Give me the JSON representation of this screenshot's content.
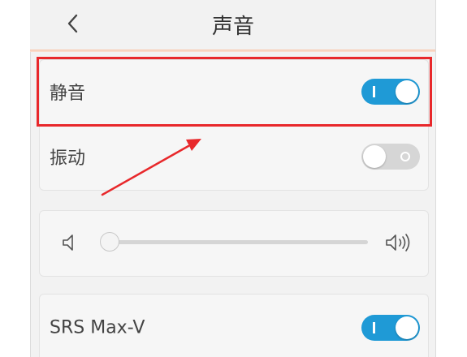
{
  "header": {
    "title": "声音",
    "back_icon": "chevron-left-icon"
  },
  "settings": {
    "mute": {
      "label": "静音",
      "on": true
    },
    "vibrate": {
      "label": "振动",
      "on": false
    },
    "volume": {
      "level": 0.0,
      "low_icon": "volume-low-icon",
      "high_icon": "volume-high-icon"
    },
    "srs": {
      "label": "SRS Max-V",
      "on": true
    }
  },
  "colors": {
    "accent": "#1f9ad6",
    "annotation": "#e8282b",
    "toggle_off": "#d6d6d6",
    "background": "#f2f2f2"
  }
}
